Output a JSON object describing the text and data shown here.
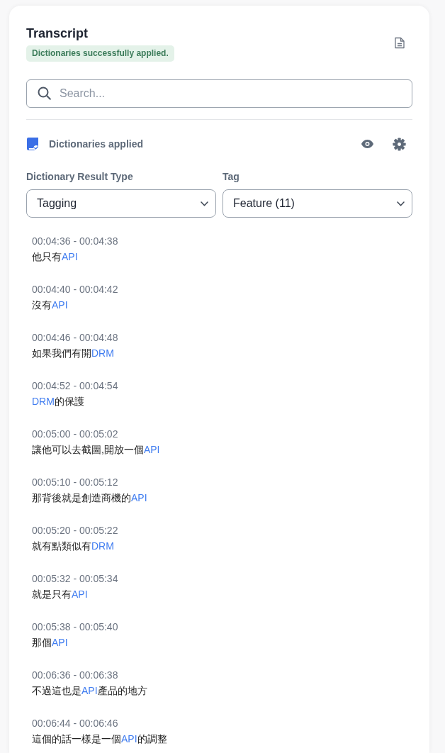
{
  "panel": {
    "title": "Transcript",
    "status_badge": "Dictionaries successfully applied."
  },
  "search": {
    "placeholder": "Search..."
  },
  "dictionaries": {
    "label": "Dictionaries applied"
  },
  "filters": [
    {
      "label": "Dictionary Result Type",
      "value": "Tagging"
    },
    {
      "label": "Tag",
      "value": "Feature (11)"
    }
  ],
  "entries": [
    {
      "time": "00:04:36 - 00:04:38",
      "segments": [
        {
          "text": "他只有",
          "highlighted": false
        },
        {
          "text": "API",
          "highlighted": true
        }
      ]
    },
    {
      "time": "00:04:40 - 00:04:42",
      "segments": [
        {
          "text": "沒有",
          "highlighted": false
        },
        {
          "text": "API",
          "highlighted": true
        }
      ]
    },
    {
      "time": "00:04:46 - 00:04:48",
      "segments": [
        {
          "text": "如果我們有開",
          "highlighted": false
        },
        {
          "text": "DRM",
          "highlighted": true
        }
      ]
    },
    {
      "time": "00:04:52 - 00:04:54",
      "segments": [
        {
          "text": "DRM",
          "highlighted": true
        },
        {
          "text": "的保護",
          "highlighted": false
        }
      ]
    },
    {
      "time": "00:05:00 - 00:05:02",
      "segments": [
        {
          "text": "讓他可以去截圖,開放一個",
          "highlighted": false
        },
        {
          "text": "API",
          "highlighted": true
        }
      ]
    },
    {
      "time": "00:05:10 - 00:05:12",
      "segments": [
        {
          "text": "那背後就是創造商機的",
          "highlighted": false
        },
        {
          "text": "API",
          "highlighted": true
        }
      ]
    },
    {
      "time": "00:05:20 - 00:05:22",
      "segments": [
        {
          "text": "就有點類似有",
          "highlighted": false
        },
        {
          "text": "DRM",
          "highlighted": true
        }
      ]
    },
    {
      "time": "00:05:32 - 00:05:34",
      "segments": [
        {
          "text": "就是只有",
          "highlighted": false
        },
        {
          "text": "API",
          "highlighted": true
        }
      ]
    },
    {
      "time": "00:05:38 - 00:05:40",
      "segments": [
        {
          "text": "那個",
          "highlighted": false
        },
        {
          "text": "API",
          "highlighted": true
        }
      ]
    },
    {
      "time": "00:06:36 - 00:06:38",
      "segments": [
        {
          "text": "不過這也是",
          "highlighted": false
        },
        {
          "text": "API",
          "highlighted": true
        },
        {
          "text": "產品的地方",
          "highlighted": false
        }
      ]
    },
    {
      "time": "00:06:44 - 00:06:46",
      "segments": [
        {
          "text": "這個的話一樣是一個",
          "highlighted": false
        },
        {
          "text": "API",
          "highlighted": true
        },
        {
          "text": "的調整",
          "highlighted": false
        }
      ]
    }
  ]
}
